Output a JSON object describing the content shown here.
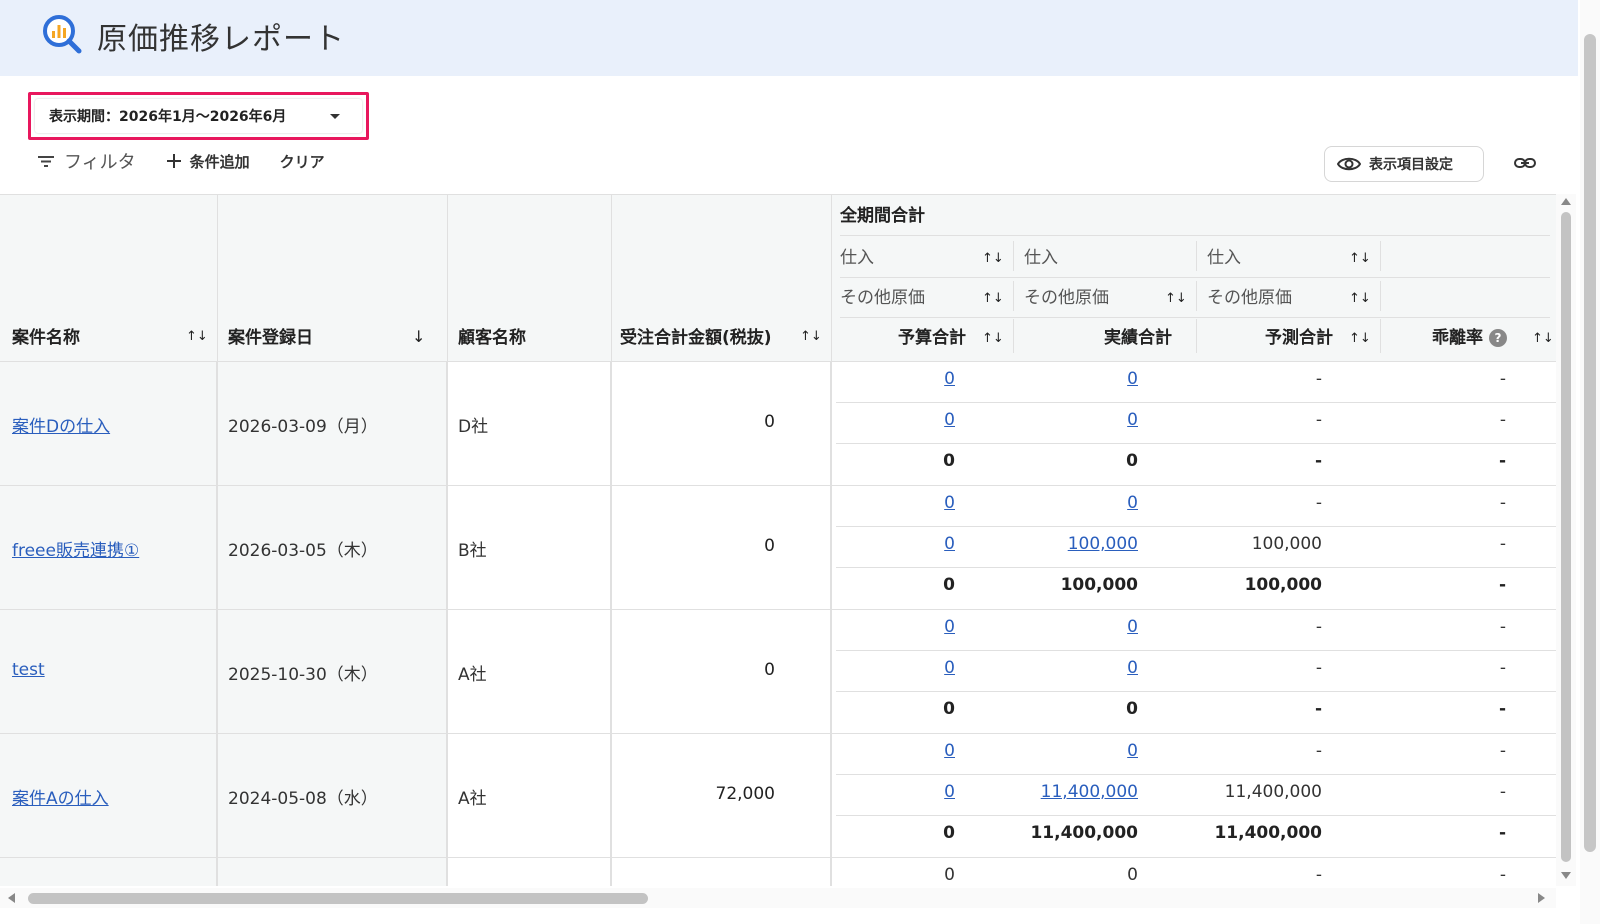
{
  "header": {
    "title": "原価推移レポート"
  },
  "period": {
    "label": "表示期間：2026年1月〜2026年6月"
  },
  "toolbar": {
    "filter": "フィルタ",
    "add_condition": "条件追加",
    "clear": "クリア"
  },
  "view_settings": {
    "label": "表示項目設定"
  },
  "table": {
    "headers": {
      "case_name": "案件名称",
      "register_date": "案件登録日",
      "customer": "顧客名称",
      "order_total": "受注合計金額(税抜)",
      "period_total": "全期間合計",
      "budget": "予算合計",
      "actual": "実績合計",
      "forecast": "予測合計",
      "deviation": "乖離率"
    },
    "sub_headers": {
      "purchase": "仕入",
      "other_cost": "その他原価"
    },
    "rows": [
      {
        "name": "案件Dの仕入",
        "date": "2026-03-09（月）",
        "customer": "D社",
        "order": "0",
        "lines": [
          {
            "budget": "0",
            "actual": "0",
            "forecast": "-",
            "dev": "-"
          },
          {
            "budget": "0",
            "actual": "0",
            "forecast": "-",
            "dev": "-"
          },
          {
            "budget": "0",
            "actual": "0",
            "forecast": "-",
            "dev": "-"
          }
        ]
      },
      {
        "name": "freee販売連携①",
        "date": "2026-03-05（木）",
        "customer": "B社",
        "order": "0",
        "lines": [
          {
            "budget": "0",
            "actual": "0",
            "forecast": "-",
            "dev": "-"
          },
          {
            "budget": "0",
            "actual": "100,000",
            "forecast": "100,000",
            "dev": "-"
          },
          {
            "budget": "0",
            "actual": "100,000",
            "forecast": "100,000",
            "dev": "-"
          }
        ]
      },
      {
        "name": "test",
        "date": "2025-10-30（木）",
        "customer": "A社",
        "order": "0",
        "lines": [
          {
            "budget": "0",
            "actual": "0",
            "forecast": "-",
            "dev": "-"
          },
          {
            "budget": "0",
            "actual": "0",
            "forecast": "-",
            "dev": "-"
          },
          {
            "budget": "0",
            "actual": "0",
            "forecast": "-",
            "dev": "-"
          }
        ]
      },
      {
        "name": "案件Aの仕入",
        "date": "2024-05-08（水）",
        "customer": "A社",
        "order": "72,000",
        "lines": [
          {
            "budget": "0",
            "actual": "0",
            "forecast": "-",
            "dev": "-"
          },
          {
            "budget": "0",
            "actual": "11,400,000",
            "forecast": "11,400,000",
            "dev": "-"
          },
          {
            "budget": "0",
            "actual": "11,400,000",
            "forecast": "11,400,000",
            "dev": "-"
          }
        ]
      }
    ],
    "partial_row": {
      "budget": "0",
      "actual": "0",
      "forecast": "-",
      "dev": "-"
    }
  }
}
